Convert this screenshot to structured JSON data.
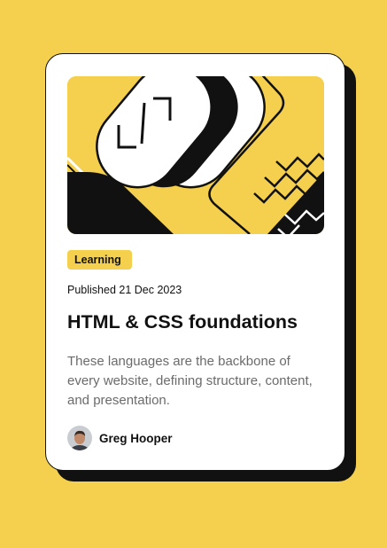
{
  "colors": {
    "page_background": "#F4D04E",
    "card_background": "#FFFFFF",
    "accent_yellow": "#F4D04E",
    "ink": "#111111",
    "muted_text": "#6B6B6B"
  },
  "card": {
    "illustration": "abstract-code-illustration",
    "category_tag": "Learning",
    "published": "Published 21 Dec 2023",
    "title": "HTML & CSS foundations",
    "description": "These languages are the backbone of every website, defining structure, content, and presentation.",
    "author": {
      "name": "Greg Hooper",
      "avatar": "author-avatar-photo"
    }
  }
}
